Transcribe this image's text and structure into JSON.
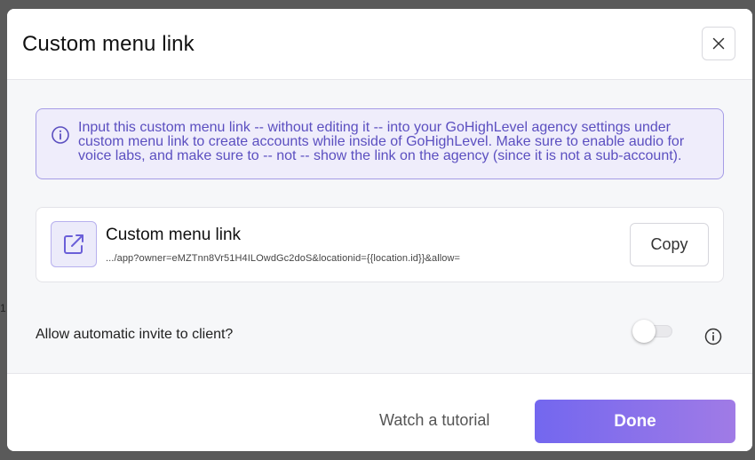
{
  "modal": {
    "title": "Custom menu link",
    "close_icon": "close-icon"
  },
  "info": {
    "icon": "info-circle-icon",
    "text": "Input this custom menu link -- without editing it -- into your GoHighLevel agency settings under custom menu link to create accounts while inside of GoHighLevel. Make sure to enable audio for voice labs, and make sure to -- not -- show the link on the agency (since it is not a sub-account)."
  },
  "link_card": {
    "icon": "external-link-icon",
    "title": "Custom menu link",
    "url": ".../app?owner=eMZTnn8Vr51H4ILOwdGc2doS&locationid={{location.id}}&allow=",
    "copy_label": "Copy"
  },
  "invite": {
    "label": "Allow automatic invite to client?",
    "enabled": false,
    "info_icon": "info-circle-icon"
  },
  "footer": {
    "tutorial_label": "Watch a tutorial",
    "done_label": "Done"
  },
  "colors": {
    "accent_start": "#7367ef",
    "accent_end": "#a07be6",
    "info_bg": "#efedfb",
    "info_border": "#a59ce6",
    "info_text": "#5b4fc0"
  },
  "backdrop": {
    "stub_text": "1"
  }
}
